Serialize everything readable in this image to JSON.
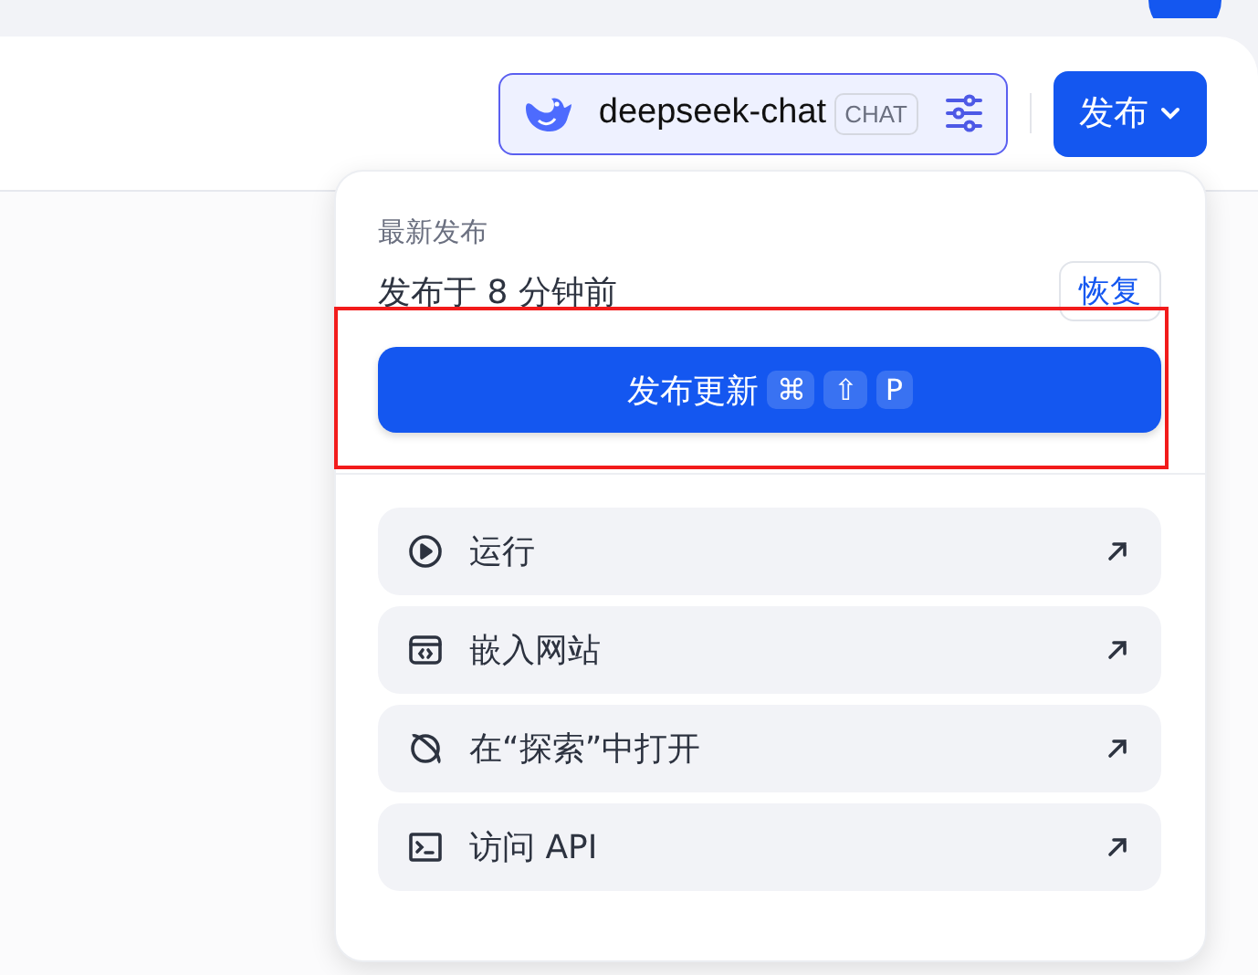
{
  "header": {
    "model": {
      "name": "deepseek-chat",
      "tag": "CHAT"
    },
    "publish_button": {
      "label": "发布"
    }
  },
  "popup": {
    "title": "最新发布",
    "status": "发布于 8 分钟前",
    "restore_button": "恢复",
    "update_button": {
      "label": "发布更新",
      "keys": [
        "⌘",
        "⇧",
        "P"
      ],
      "highlighted": true
    },
    "actions": [
      {
        "kind": "run",
        "label": "运行"
      },
      {
        "kind": "embed",
        "label": "嵌入网站"
      },
      {
        "kind": "explore",
        "label": "在“探索”中打开"
      },
      {
        "kind": "api",
        "label": "访问 API"
      }
    ]
  }
}
